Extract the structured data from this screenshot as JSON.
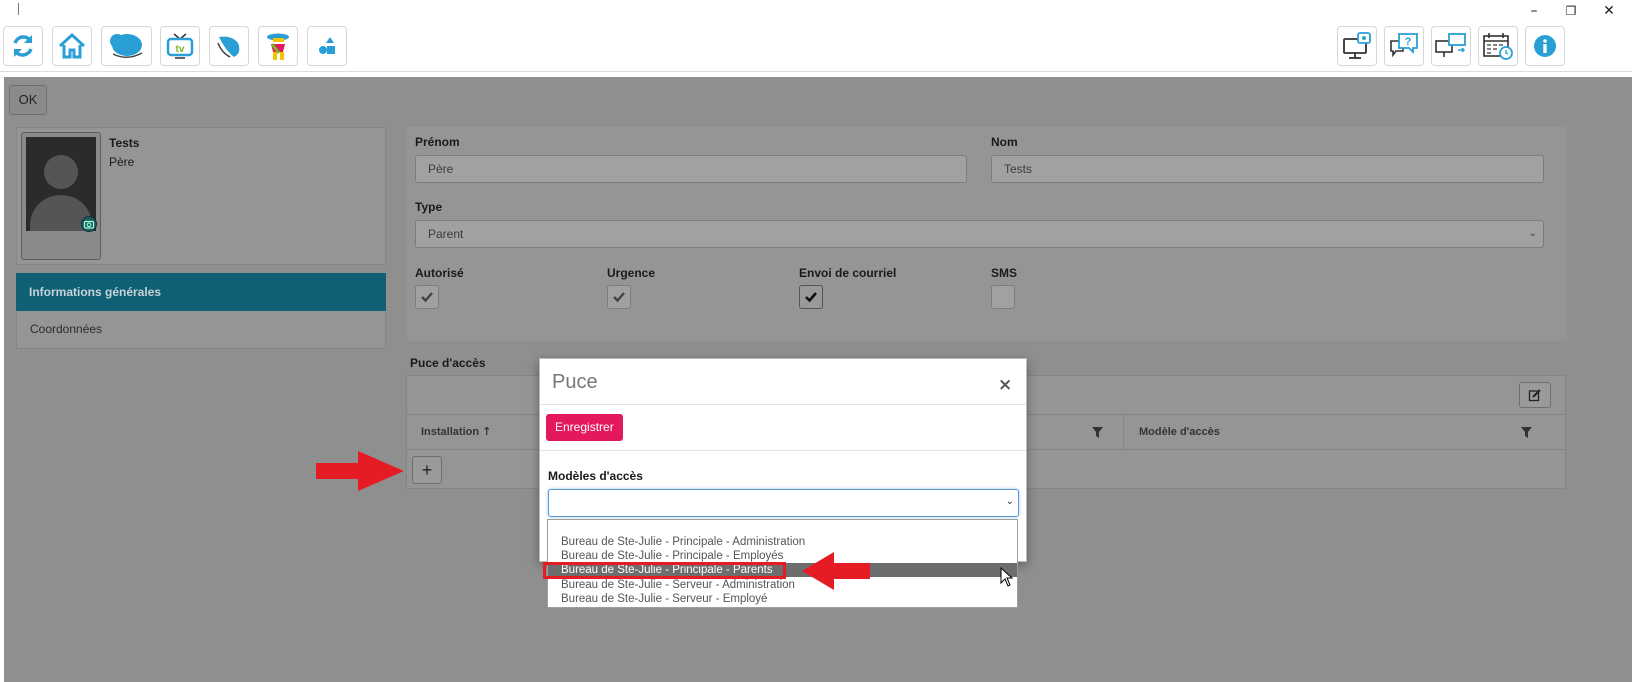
{
  "window_controls": {
    "minimize": "–",
    "restore": "❐",
    "close": "✕"
  },
  "toolbar": {
    "left_icons": [
      "refresh-icon",
      "home-icon",
      "cloud-icon",
      "tv-icon",
      "butterfly-icon",
      "character-icon",
      "shapes-icon"
    ],
    "right_icons": [
      "monitor-settings-icon",
      "help-chat-icon",
      "remote-monitors-icon",
      "calendar-clock-icon",
      "info-icon"
    ],
    "tv_label": "tv"
  },
  "colors": {
    "accent_teal": "#2a9fd6",
    "nav_active": "#0f5f75",
    "save_pink": "#e3185f",
    "annotation_red": "#e61c24"
  },
  "actions": {
    "ok_label": "OK"
  },
  "profile": {
    "name": "Tests",
    "role": "Père"
  },
  "nav": {
    "general": "Informations générales",
    "coordinates": "Coordonnées"
  },
  "form": {
    "prenom_label": "Prénom",
    "prenom_value": "Père",
    "nom_label": "Nom",
    "nom_value": "Tests",
    "type_label": "Type",
    "type_value": "Parent",
    "autorise_label": "Autorisé",
    "urgence_label": "Urgence",
    "envoi_label": "Envoi de courriel",
    "sms_label": "SMS",
    "checks": {
      "autorise": true,
      "urgence": true,
      "envoi": true,
      "sms": false
    }
  },
  "puce_section": {
    "title": "Puce d'accès",
    "col_installation": "Installation",
    "col_sort_glyph": "↑",
    "col_modele": "Modèle d'accès",
    "add_label": "+"
  },
  "modal": {
    "title": "Puce",
    "close": "×",
    "save_label": "Enregistrer",
    "field_label": "Modèles d'accès",
    "selected_value": "",
    "options": [
      "Bureau de Ste-Julie - Principale - Administration",
      "Bureau de Ste-Julie - Principale - Employés",
      "Bureau de Ste-Julie - Principale - Parents",
      "Bureau de Ste-Julie - Serveur - Administration",
      "Bureau de Ste-Julie - Serveur - Employé"
    ],
    "highlighted_index": 2
  }
}
